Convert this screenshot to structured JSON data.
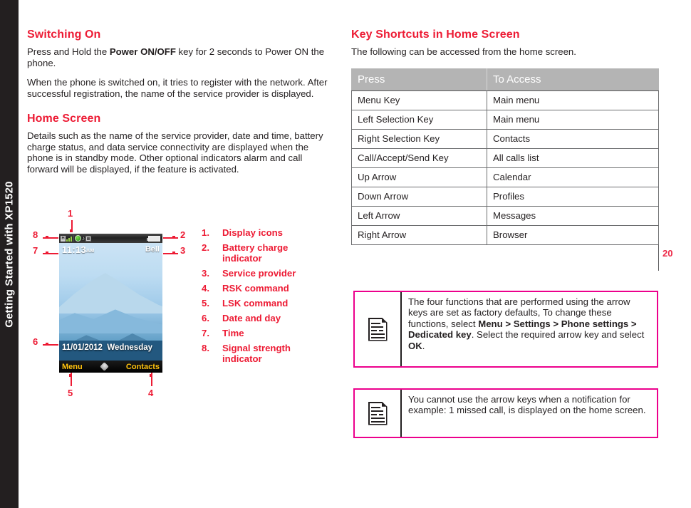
{
  "sidebar": {
    "tab_label": "Getting Started with XP1520",
    "page_number": "20"
  },
  "left_column": {
    "section1": {
      "heading": "Switching On",
      "para1_pre": "Press and Hold the ",
      "para1_bold": "Power ON/OFF",
      "para1_post": " key for 2 seconds to Power ON the phone.",
      "para2": "When the phone is switched on, it tries to register with the network. After successful registration, the name of the service provider is displayed."
    },
    "section2": {
      "heading": "Home Screen",
      "para1": "Details such as the name of the service provider, date and time, battery charge status, and data service connectivity are displayed when the phone is in standby mode. Other optional indicators alarm and call forward will be displayed, if the feature is activated."
    }
  },
  "figure": {
    "callouts": [
      "1",
      "2",
      "3",
      "4",
      "5",
      "6",
      "7",
      "8"
    ],
    "phone_screen": {
      "time": "11:13",
      "time_meridiem": "AM",
      "carrier": "Bell",
      "date": "11/01/2012",
      "day": "Wednesday",
      "left_softkey": "Menu",
      "right_softkey": "Contacts",
      "status_icons": [
        "hsdpa-icon",
        "signal-strength-icon",
        "data-connection-icon",
        "music-note-icon",
        "memory-card-icon",
        "battery-icon"
      ]
    },
    "legend": [
      {
        "num": "1.",
        "text": "Display icons"
      },
      {
        "num": "2.",
        "text": "Battery charge indicator"
      },
      {
        "num": "3.",
        "text": "Service provider"
      },
      {
        "num": "4.",
        "text": "RSK command"
      },
      {
        "num": "5.",
        "text": "LSK command"
      },
      {
        "num": "6.",
        "text": "Date and day"
      },
      {
        "num": "7.",
        "text": "Time"
      },
      {
        "num": "8.",
        "text": "Signal strength indicator"
      }
    ]
  },
  "right_column": {
    "heading": "Key Shortcuts in Home Screen",
    "intro": "The following can be accessed from the home screen.",
    "table": {
      "headers": [
        "Press",
        "To Access"
      ],
      "rows": [
        [
          "Menu Key",
          "Main menu"
        ],
        [
          "Left Selection Key",
          "Main menu"
        ],
        [
          "Right Selection Key",
          "Contacts"
        ],
        [
          "Call/Accept/Send Key",
          "All calls list"
        ],
        [
          "Up Arrow",
          "Calendar"
        ],
        [
          "Down Arrow",
          "Profiles"
        ],
        [
          "Left Arrow",
          "Messages"
        ],
        [
          "Right Arrow",
          "Browser"
        ]
      ]
    },
    "notes": [
      {
        "segments": [
          {
            "text": "The four functions that are performed using the arrow keys are set as factory defaults, To change these functions, select ",
            "bold": false
          },
          {
            "text": "Menu > Settings > Phone settings > Dedicated key",
            "bold": true
          },
          {
            "text": ". Select the required arrow key and select ",
            "bold": false
          },
          {
            "text": "OK",
            "bold": true
          },
          {
            "text": ".",
            "bold": false
          }
        ]
      },
      {
        "segments": [
          {
            "text": "You cannot use the arrow keys when a notification for example: 1 missed call, is displayed on the home screen.",
            "bold": false
          }
        ]
      }
    ]
  },
  "colors": {
    "accent_red": "#ed1b34",
    "magenta": "#ec008c",
    "table_header_gray": "#b4b4b4",
    "sidebar_black": "#231f20",
    "softkey_yellow": "#ffc20e"
  }
}
